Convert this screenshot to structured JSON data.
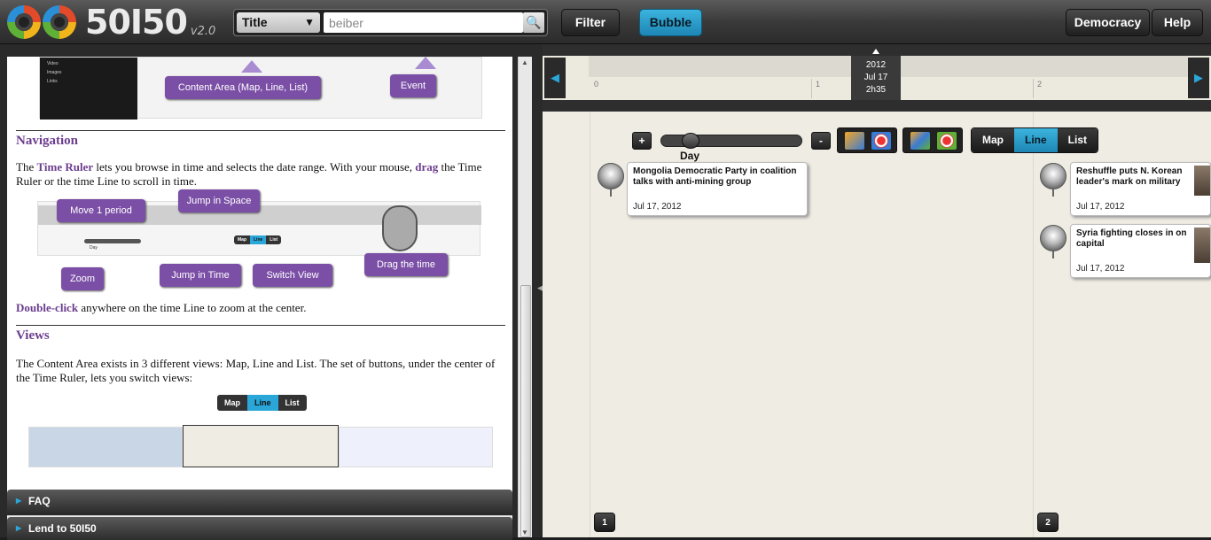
{
  "app": {
    "logo_text": "50I50",
    "version": "v2.0"
  },
  "search": {
    "field": "Title",
    "value": "beiber",
    "placeholder": ""
  },
  "toolbar": {
    "filter": "Filter",
    "bubble": "Bubble",
    "democracy": "Democracy",
    "help": "Help"
  },
  "doc": {
    "callouts": {
      "content_area": "Content Area (Map, Line, List)",
      "event": "Event",
      "move": "Move 1 period",
      "jump_space": "Jump in Space",
      "zoom": "Zoom",
      "jump_time": "Jump in Time",
      "switch_view": "Switch View",
      "drag_time": "Drag the time"
    },
    "nav_heading": "Navigation",
    "nav_p_1": "The ",
    "nav_p_time_ruler": "Time Ruler",
    "nav_p_2": " lets you browse in time and selects the date range. With your mouse, ",
    "nav_p_drag": "drag",
    "nav_p_3": " the Time Ruler or the time Line to scroll in time.",
    "dbl_bold": "Double-click",
    "dbl_rest": " anywhere on the time Line to zoom at the center.",
    "views_heading": "Views",
    "views_p": "The Content Area exists in 3 different views: Map, Line and List. The set of buttons, under the center of the Time Ruler, lets you switch views:",
    "mini_buttons": [
      "Map",
      "Line",
      "List"
    ],
    "mini_selected": "Line",
    "screenshot_sidebar": [
      "Video",
      "Images",
      "Links"
    ],
    "mini_day": "Day"
  },
  "accordion": [
    "FAQ",
    "Lend to 50I50"
  ],
  "ruler": {
    "ticks": [
      "0",
      "1",
      "2"
    ],
    "cursor": {
      "year": "2012",
      "date": "Jul 17",
      "time": "2h35"
    }
  },
  "controls": {
    "plus": "+",
    "minus": "-",
    "zoom_label": "Day",
    "zoom_level": 0.2,
    "views": [
      "Map",
      "Line",
      "List"
    ],
    "selected_view": "Line"
  },
  "events": [
    {
      "title": "Mongolia Democratic Party in coalition talks with anti-mining group",
      "date": "Jul 17, 2012"
    },
    {
      "title": "Reshuffle puts N. Korean leader's mark on military",
      "date": "Jul 17, 2012"
    },
    {
      "title": "Syria fighting closes in on capital",
      "date": "Jul 17, 2012"
    }
  ],
  "pages": [
    "1",
    "2"
  ],
  "colors": {
    "accent": "#2aa6d8",
    "purple": "#6b3d8e",
    "callout": "#7b4fa6"
  }
}
